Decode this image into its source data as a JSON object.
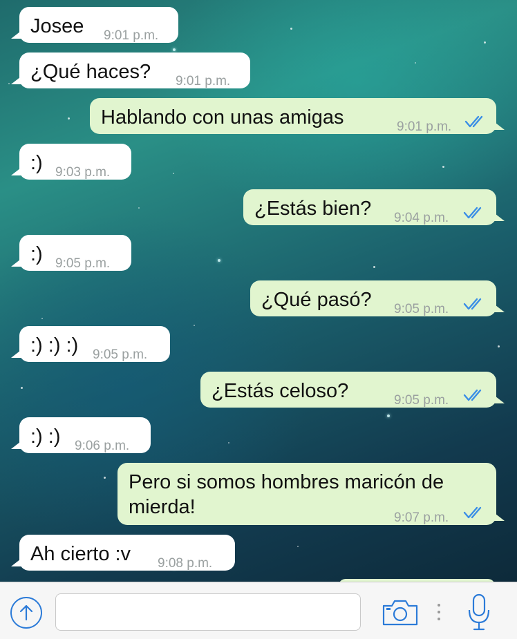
{
  "conversation": {
    "messages": [
      {
        "dir": "in",
        "text": "Josee",
        "time": "9:01 p.m."
      },
      {
        "dir": "in",
        "text": "¿Qué haces?",
        "time": "9:01 p.m."
      },
      {
        "dir": "out",
        "text": "Hablando con unas amigas",
        "time": "9:01 p.m."
      },
      {
        "dir": "in",
        "text": ":)",
        "time": "9:03 p.m."
      },
      {
        "dir": "out",
        "text": "¿Estás bien?",
        "time": "9:04 p.m."
      },
      {
        "dir": "in",
        "text": ":)",
        "time": "9:05 p.m."
      },
      {
        "dir": "out",
        "text": "¿Qué pasó?",
        "time": "9:05 p.m."
      },
      {
        "dir": "in",
        "text": ":) :) :)",
        "time": "9:05 p.m."
      },
      {
        "dir": "out",
        "text": "¿Estás celoso?",
        "time": "9:05 p.m."
      },
      {
        "dir": "in",
        "text": ":) :)",
        "time": "9:06 p.m."
      },
      {
        "dir": "out",
        "text_line1": "Pero si somos hombres maricón de",
        "text_line2": "mierda!",
        "time": "9:07 p.m."
      },
      {
        "dir": "in",
        "text": "Ah cierto :v",
        "time": "9:08 p.m."
      }
    ]
  },
  "composer": {
    "input_value": "",
    "input_placeholder": "",
    "upload_icon": "arrow-up-circle-icon",
    "camera_icon": "camera-icon",
    "mic_icon": "microphone-icon"
  },
  "colors": {
    "incoming_bubble": "#ffffff",
    "outgoing_bubble": "#e1f5cf",
    "read_check": "#3a8ee6",
    "accent": "#2c7bd8"
  }
}
